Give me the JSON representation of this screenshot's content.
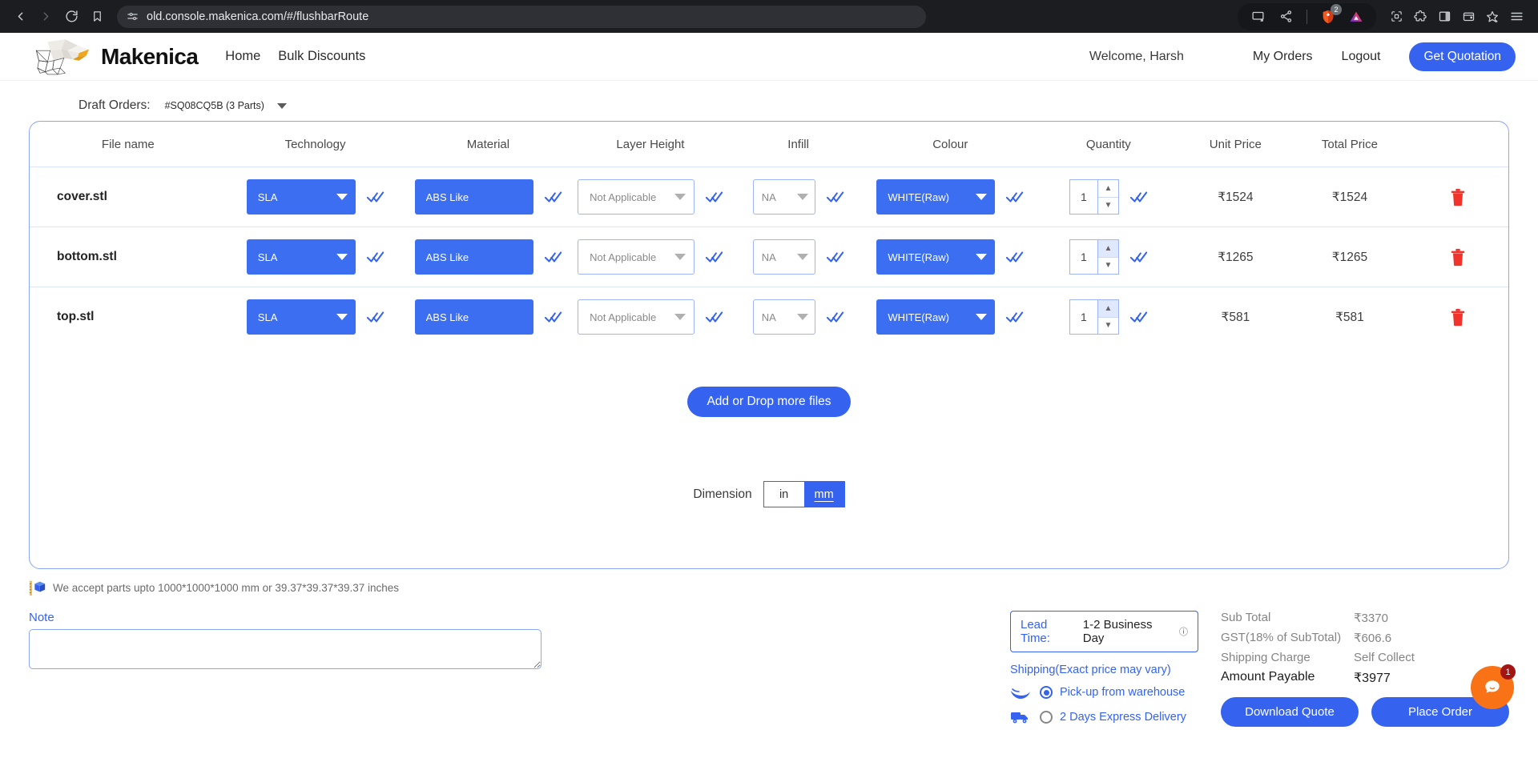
{
  "browser": {
    "url": "old.console.makenica.com/#/flushbarRoute",
    "back_icon": "back-arrow-icon",
    "forward_icon": "forward-arrow-icon",
    "reload_icon": "reload-icon",
    "bookmark_icon": "bookmark-icon",
    "site_settings_icon": "site-settings-icon",
    "cast_icon": "cast-icon",
    "share_icon": "share-icon",
    "brave_shield_icon": "brave-shields-icon",
    "brave_shield_count": "2",
    "brave_leo_icon": "brave-leo-icon",
    "qr_icon": "qr-code-icon",
    "extensions_icon": "extensions-puzzle-icon",
    "sidepanel_icon": "side-panel-icon",
    "wallet_icon": "brave-wallet-icon",
    "favorites_icon": "add-favorite-icon",
    "menu_icon": "hamburger-menu-icon"
  },
  "header": {
    "brand": "Makenica",
    "nav": [
      {
        "label": "Home"
      },
      {
        "label": "Bulk Discounts"
      }
    ],
    "welcome": "Welcome, Harsh",
    "my_orders": "My Orders",
    "logout": "Logout",
    "get_quotation": "Get Quotation",
    "accent": "#3563f0"
  },
  "draft": {
    "label": "Draft Orders:",
    "value": "#SQ08CQ5B (3 Parts)"
  },
  "table": {
    "columns": [
      "File name",
      "Technology",
      "Material",
      "Layer Height",
      "Infill",
      "Colour",
      "Quantity",
      "Unit Price",
      "Total Price"
    ],
    "rows": [
      {
        "file": "cover.stl",
        "technology": "SLA",
        "material": "ABS Like",
        "layer_height": "Not Applicable",
        "infill": "NA",
        "colour": "WHITE(Raw)",
        "quantity": "1",
        "unit_price": "₹1524",
        "total_price": "₹1524",
        "spinner_up_active": false
      },
      {
        "file": "bottom.stl",
        "technology": "SLA",
        "material": "ABS Like",
        "layer_height": "Not Applicable",
        "infill": "NA",
        "colour": "WHITE(Raw)",
        "quantity": "1",
        "unit_price": "₹1265",
        "total_price": "₹1265",
        "spinner_up_active": true
      },
      {
        "file": "top.stl",
        "technology": "SLA",
        "material": "ABS Like",
        "layer_height": "Not Applicable",
        "infill": "NA",
        "colour": "WHITE(Raw)",
        "quantity": "1",
        "unit_price": "₹581",
        "total_price": "₹581",
        "spinner_up_active": true
      }
    ],
    "add_files_button": "Add or Drop more files",
    "dimension_label": "Dimension",
    "dimension_options": [
      {
        "label": "in",
        "selected": false
      },
      {
        "label": "mm",
        "selected": true
      }
    ]
  },
  "size_notice": "We accept parts upto 1000*1000*1000 mm or 39.37*39.37*39.37 inches",
  "note": {
    "label": "Note",
    "value": "",
    "placeholder": ""
  },
  "shipping": {
    "lead_time_key": "Lead Time:",
    "lead_time_value": "1-2 Business Day",
    "title": "Shipping(Exact price may vary)",
    "options": [
      {
        "label": "Pick-up from warehouse",
        "selected": true,
        "icon": "pickup-hand-icon"
      },
      {
        "label": "2 Days Express Delivery",
        "selected": false,
        "icon": "delivery-truck-icon"
      }
    ]
  },
  "summary": {
    "rows": [
      {
        "key": "Sub Total",
        "value": "₹3370",
        "strong": false
      },
      {
        "key": "GST(18% of SubTotal)",
        "value": "₹606.6",
        "strong": false
      },
      {
        "key": "Shipping Charge",
        "value": "Self Collect",
        "strong": false
      },
      {
        "key": "Amount Payable",
        "value": "₹3977",
        "strong": true
      }
    ],
    "download_quote": "Download Quote",
    "place_order": "Place Order"
  },
  "chat": {
    "badge": "1",
    "icon": "chat-bubble-icon"
  }
}
